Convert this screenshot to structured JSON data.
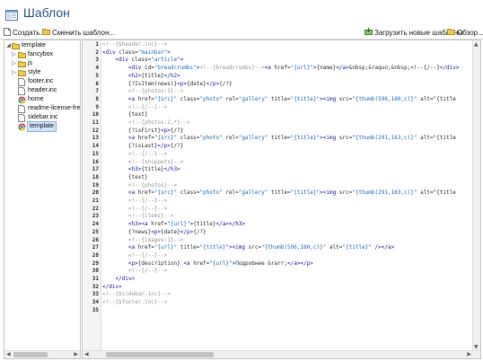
{
  "window": {
    "title": "Шаблон"
  },
  "toolbar": {
    "create_label": "Создать...",
    "change_label": "Сменить шаблон...",
    "load_label": "Загрузить новые шаблоны",
    "browse_label": "Обзор..."
  },
  "tree": {
    "items": [
      {
        "label": "template",
        "icon": "folder-open-icon"
      },
      {
        "label": "fancybox",
        "icon": "folder-icon"
      },
      {
        "label": "js",
        "icon": "folder-icon"
      },
      {
        "label": "style",
        "icon": "folder-icon"
      },
      {
        "label": "footer.inc",
        "icon": "file-icon"
      },
      {
        "label": "header.inc",
        "icon": "file-icon"
      },
      {
        "label": "home",
        "icon": "chrome-icon"
      },
      {
        "label": "readme-license-freew",
        "icon": "file-icon"
      },
      {
        "label": "sidebar.inc",
        "icon": "file-icon"
      },
      {
        "label": "template",
        "icon": "chrome-icon"
      }
    ]
  },
  "editor": {
    "lines": [
      "<!--{$header.inc}-->",
      "<div class=\"mainbar\">",
      "    <div class=\"article\">",
      "        <div id=\"breadcrumbs\"><!--{breadcrumbs}--><a href=\"{url}\">{name}</a>&nbsp;&raquo;&nbsp;<!--{/--}</div>",
      "        <h2>{title}</h2>",
      "        {?IsItem(news)}<p>{date}</p>{/?}",
      "        <!--{photos:1}-->",
      "        <a href=\"{src}\" class=\"photo\" rel=\"gallery\" title=\"{title}\"><img src=\"{thumb(596,180,c)}\" alt=\"{title",
      "        <!--{/--}-->",
      "        {text}",
      "        <!--{photos:2,*}-->",
      "        {?isFirst}<p>{/?}",
      "        <a href=\"{src}\" class=\"photo\" rel=\"gallery\" title=\"{title}\"><img src=\"{thumb(291,163,c)}\" alt=\"{title",
      "        {?isLast}</p>{/?}",
      "        <!--{/--}-->",
      "        <!--{snippets}-->",
      "        <h3>{title}</h3>",
      "        {text}",
      "        <!--{photos}-->",
      "        <a href=\"{src}\" class=\"photo\" rel=\"gallery\" title=\"{title}\"><img src=\"{thumb(291,163,c)}\" alt=\"{title",
      "        <!--{/--}-->",
      "        <!--{/--}-->",
      "        <!--{items}-->",
      "        <h3><a href=\"{url}\">{title}</a></h3>",
      "        {?news}<p>{date}</p>{/?}",
      "        <!--{images:1}-->",
      "        <a href=\"{url}\" title=\"{title}\"><img src=\"{thumb(596,180,c)}\" alt=\"{title}\" /></a>",
      "        <!--{/--}-->",
      "        <p>{description} <a href=\"{url}\">Подробнее &rarr;</a></p>",
      "        <!--{/--}-->",
      "    </div>",
      "</div>",
      "<!--{$sidebar.inc}-->",
      "<!--{$footer.inc}-->",
      ""
    ]
  },
  "colors": {
    "title": "#2b5a8c",
    "tag": "#2020a0",
    "string": "#1e6fbf",
    "comment": "#999999",
    "selected_bg": "#cfe3fa"
  }
}
